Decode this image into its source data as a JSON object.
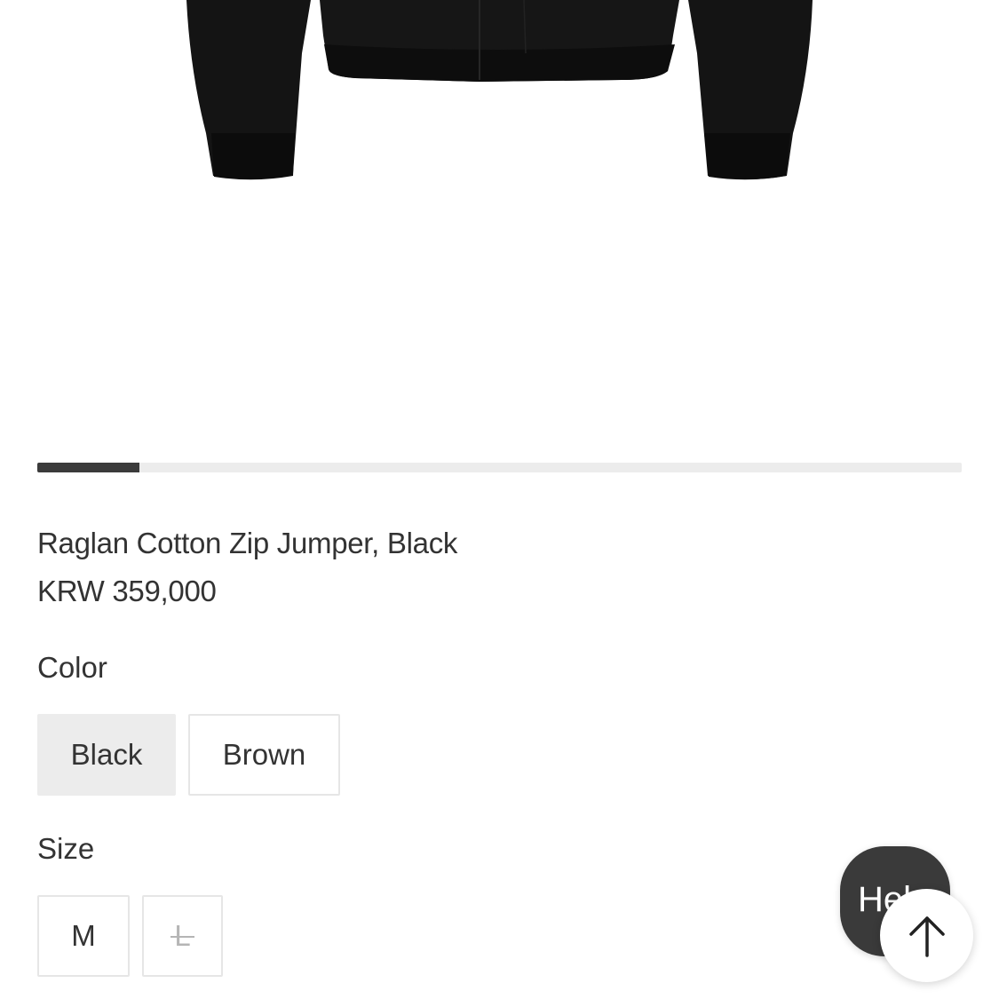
{
  "product": {
    "title": "Raglan Cotton Zip Jumper, Black",
    "price": "KRW 359,000",
    "image_icon": "jacket-product-image"
  },
  "gallery": {
    "progress_fraction": 0.11
  },
  "color_option": {
    "label": "Color",
    "options": [
      {
        "label": "Black",
        "selected": true
      },
      {
        "label": "Brown",
        "selected": false
      }
    ]
  },
  "size_option": {
    "label": "Size",
    "options": [
      {
        "label": "M",
        "available": true
      },
      {
        "label": "L",
        "available": false
      }
    ]
  },
  "help": {
    "label": "Help",
    "icon": "arrow-up-icon"
  },
  "colors": {
    "accent": "#3b3b3b",
    "selected_bg": "#ececec",
    "help_bg": "#3a3a3a"
  }
}
